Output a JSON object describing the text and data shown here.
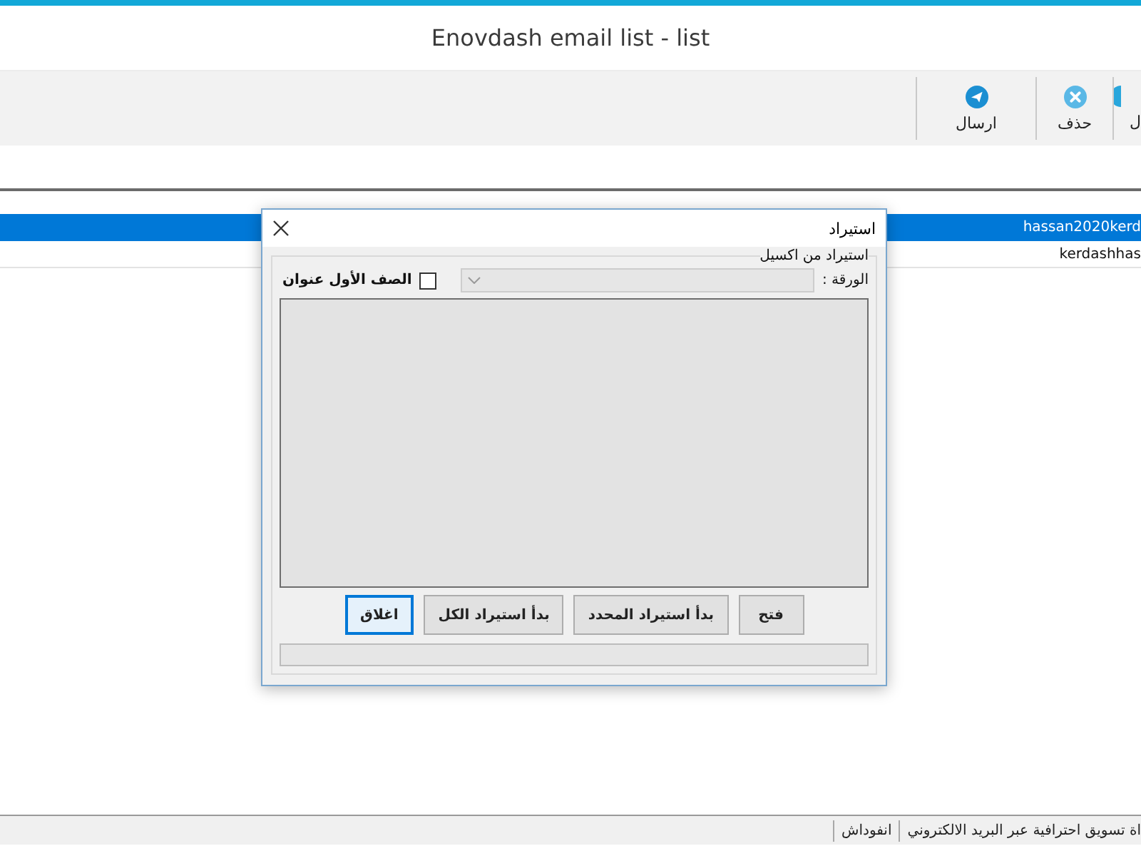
{
  "window": {
    "title": "Enovdash email list - list"
  },
  "toolbar": [
    {
      "label": "ل",
      "kind": "cut"
    },
    {
      "label": "حذف",
      "kind": "delete"
    },
    {
      "label": "ارسال",
      "kind": "send"
    }
  ],
  "grid": {
    "rows": [
      {
        "column_1": "hassan2020kerd",
        "selected": true
      },
      {
        "column_1": "kerdashhas",
        "selected": false
      }
    ]
  },
  "dialog": {
    "title": "استيراد",
    "group_label": "استيراد من اكسيل",
    "sheet_label": "الورقة :",
    "sheet_select": {
      "disabled": true
    },
    "header_checkbox": {
      "label": "الصف الأول عنوان",
      "checked": false
    },
    "buttons": [
      {
        "label": "فتح",
        "focused": false
      },
      {
        "label": "بدأ استيراد المحدد",
        "focused": false
      },
      {
        "label": "بدأ استيراد الكل",
        "focused": false
      },
      {
        "label": "اغلاق",
        "focused": true
      }
    ],
    "progress": {
      "level": 0
    }
  },
  "status_bar": [
    {
      "text": "اة تسويق احترافية عبر البريد الالكتروني"
    },
    {
      "text": "انفوداش"
    }
  ]
}
